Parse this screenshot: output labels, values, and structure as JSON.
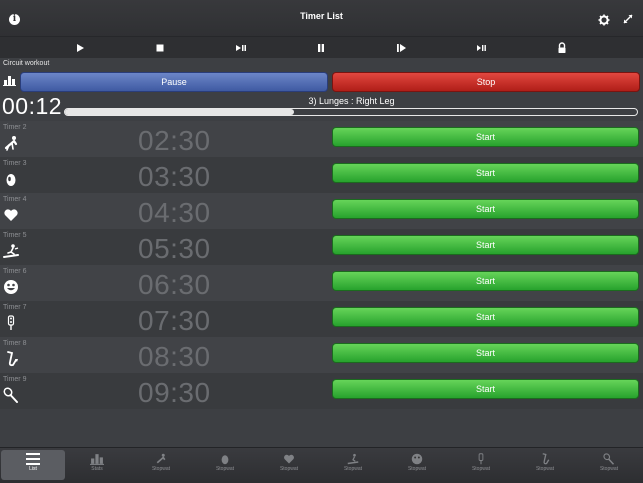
{
  "header": {
    "title": "Timer List",
    "info_icon": "info-icon",
    "settings_icon": "gear-icon",
    "expand_icon": "expand-icon"
  },
  "controls": [
    "play-icon",
    "stop-icon",
    "play-pause-icon",
    "pause-icon",
    "step-forward-icon",
    "pause-step-icon",
    "lock-icon"
  ],
  "workout": {
    "section_label": "Circuit workout",
    "pause_label": "Pause",
    "stop_label": "Stop",
    "current_time": "00:12",
    "current_step": "3) Lunges : Right Leg",
    "progress": 0.4
  },
  "timers": [
    {
      "label": "Timer 2",
      "time": "02:30",
      "start_label": "Start",
      "icon": "pushups-icon"
    },
    {
      "label": "Timer 3",
      "time": "03:30",
      "start_label": "Start",
      "icon": "egg-icon"
    },
    {
      "label": "Timer 4",
      "time": "04:30",
      "start_label": "Start",
      "icon": "heart-icon"
    },
    {
      "label": "Timer 5",
      "time": "05:30",
      "start_label": "Start",
      "icon": "treadmill-icon"
    },
    {
      "label": "Timer 6",
      "time": "06:30",
      "start_label": "Start",
      "icon": "smiley-icon"
    },
    {
      "label": "Timer 7",
      "time": "07:30",
      "start_label": "Start",
      "icon": "traffic-light-icon"
    },
    {
      "label": "Timer 8",
      "time": "08:30",
      "start_label": "Start",
      "icon": "saxophone-icon"
    },
    {
      "label": "Timer 9",
      "time": "09:30",
      "start_label": "Start",
      "icon": "tennis-racket-icon"
    }
  ],
  "tabbar": [
    {
      "label": "List",
      "icon": "list-icon",
      "active": true
    },
    {
      "label": "Stats",
      "icon": "stats-icon",
      "active": false
    },
    {
      "label": "Stopwat",
      "icon": "pushups-icon",
      "active": false
    },
    {
      "label": "Stopwat",
      "icon": "egg-icon",
      "active": false
    },
    {
      "label": "Stopwat",
      "icon": "heart-icon",
      "active": false
    },
    {
      "label": "Stopwat",
      "icon": "treadmill-icon",
      "active": false
    },
    {
      "label": "Stopwat",
      "icon": "smiley-icon",
      "active": false
    },
    {
      "label": "Stopwat",
      "icon": "traffic-light-icon",
      "active": false
    },
    {
      "label": "Stopwat",
      "icon": "saxophone-icon",
      "active": false
    },
    {
      "label": "Stopwat",
      "icon": "tennis-racket-icon",
      "active": false
    }
  ]
}
